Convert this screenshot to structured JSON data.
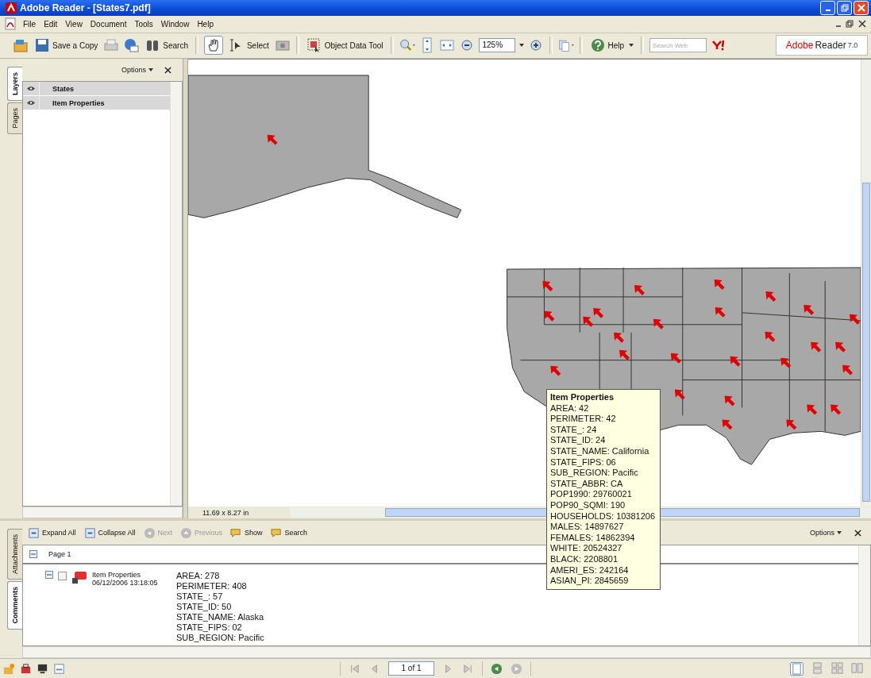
{
  "window": {
    "title": "Adobe Reader - [States7.pdf]"
  },
  "menu": [
    {
      "label": "File"
    },
    {
      "label": "Edit"
    },
    {
      "label": "View"
    },
    {
      "label": "Document"
    },
    {
      "label": "Tools"
    },
    {
      "label": "Window"
    },
    {
      "label": "Help"
    }
  ],
  "toolbar": {
    "save_copy": "Save a Copy",
    "search": "Search",
    "select": "Select",
    "object_data_tool": "Object Data Tool",
    "zoom": "125%",
    "help": "Help",
    "search_web_placeholder": "Search Web"
  },
  "brand": {
    "name_1": "Adobe",
    "name_2": "Reader",
    "version": "7.0"
  },
  "side_tabs": [
    {
      "label": "Layers",
      "selected": true
    },
    {
      "label": "Pages",
      "selected": false
    }
  ],
  "layers_panel": {
    "options": "Options",
    "layers": [
      {
        "name": "States",
        "visible": true
      },
      {
        "name": "Item Properties",
        "visible": true
      }
    ]
  },
  "document": {
    "page_size": "11.69 x 8.27 in"
  },
  "tooltip": {
    "title": "Item Properties",
    "lines": [
      "AREA: 42",
      "PERIMETER: 42",
      "STATE_: 24",
      "STATE_ID: 24",
      "STATE_NAME: California",
      "STATE_FIPS: 06",
      "SUB_REGION: Pacific",
      "STATE_ABBR: CA",
      "POP1990: 29760021",
      "POP90_SQMI: 190",
      "HOUSEHOLDS: 10381206",
      "MALES: 14897627",
      "FEMALES: 14862394",
      "WHITE: 20524327",
      "BLACK: 2208801",
      "AMERI_ES: 242164",
      "ASIAN_PI: 2845659"
    ]
  },
  "bottom_tabs": [
    {
      "label": "Attachments",
      "selected": false
    },
    {
      "label": "Comments",
      "selected": true
    }
  ],
  "comments_toolbar": [
    {
      "label": "Expand All",
      "disabled": false
    },
    {
      "label": "Collapse All",
      "disabled": false
    },
    {
      "label": "Next",
      "disabled": true
    },
    {
      "label": "Previous",
      "disabled": true
    },
    {
      "label": "Show",
      "disabled": false
    },
    {
      "label": "Search",
      "disabled": false
    }
  ],
  "comments_options": "Options",
  "comments": {
    "page": "Page 1",
    "items": [
      {
        "title": "Item Properties",
        "date": "06/12/2006 13:18:05",
        "checked": false,
        "lines": [
          "AREA: 278",
          "PERIMETER: 408",
          "STATE_: 57",
          "STATE_ID: 50",
          "STATE_NAME: Alaska",
          "STATE_FIPS: 02",
          "SUB_REGION: Pacific"
        ]
      }
    ]
  },
  "status_bar": {
    "page": "1 of 1"
  }
}
